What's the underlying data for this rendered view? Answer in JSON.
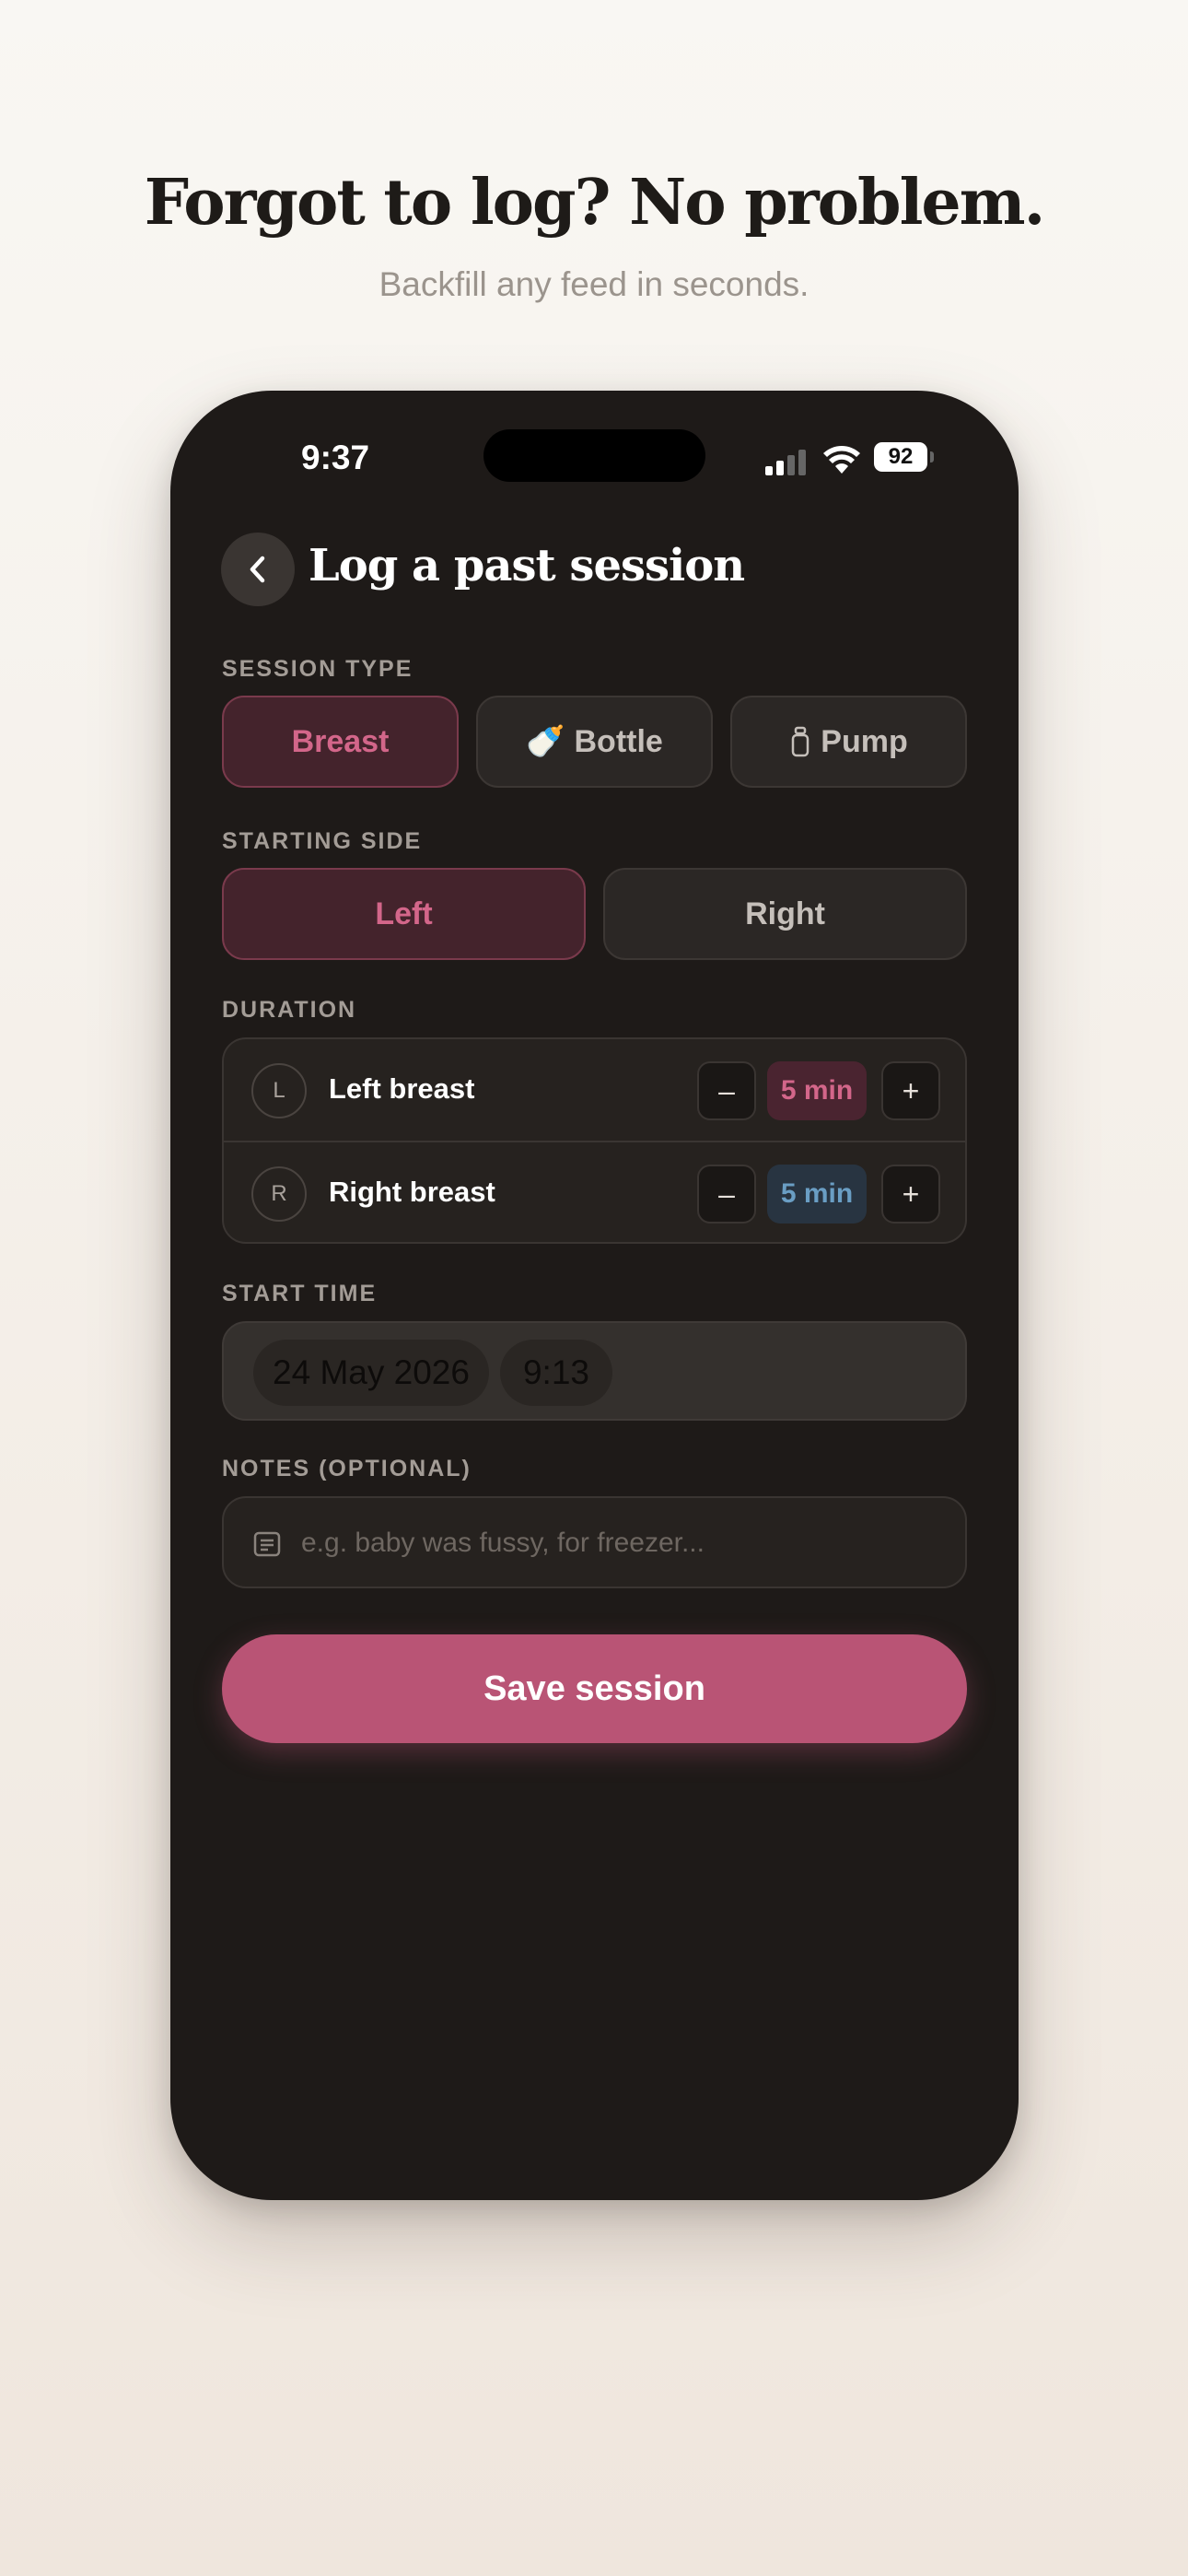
{
  "marketing": {
    "headline": "Forgot to log? No problem.",
    "subheadline": "Backfill any feed in seconds."
  },
  "status_bar": {
    "time": "9:37",
    "battery": "92"
  },
  "header": {
    "back_icon": "chevron-left-icon",
    "title": "Log a past session"
  },
  "session_type": {
    "label": "SESSION TYPE",
    "options": [
      {
        "label": "Breast",
        "icon": "",
        "selected": true
      },
      {
        "label": "Bottle",
        "icon": "🍼",
        "selected": false
      },
      {
        "label": "Pump",
        "icon": "⛽",
        "selected": false
      }
    ]
  },
  "starting_side": {
    "label": "STARTING SIDE",
    "options": [
      {
        "label": "Left",
        "selected": true
      },
      {
        "label": "Right",
        "selected": false
      }
    ]
  },
  "duration": {
    "label": "DURATION",
    "rows": [
      {
        "badge": "L",
        "label": "Left breast",
        "minus": "–",
        "value": "5 min",
        "plus": "+"
      },
      {
        "badge": "R",
        "label": "Right breast",
        "minus": "–",
        "value": "5 min",
        "plus": "+"
      }
    ]
  },
  "start_time": {
    "label": "START TIME",
    "date": "24 May 2026",
    "time": "9:13"
  },
  "notes": {
    "label": "NOTES (OPTIONAL)",
    "placeholder": "e.g. baby was fussy, for freezer..."
  },
  "save_button": "Save session",
  "colors": {
    "accent": "#b95475",
    "accent_text": "#d3668a",
    "right_accent": "#6a9ec4",
    "background": "#1e1a18"
  }
}
